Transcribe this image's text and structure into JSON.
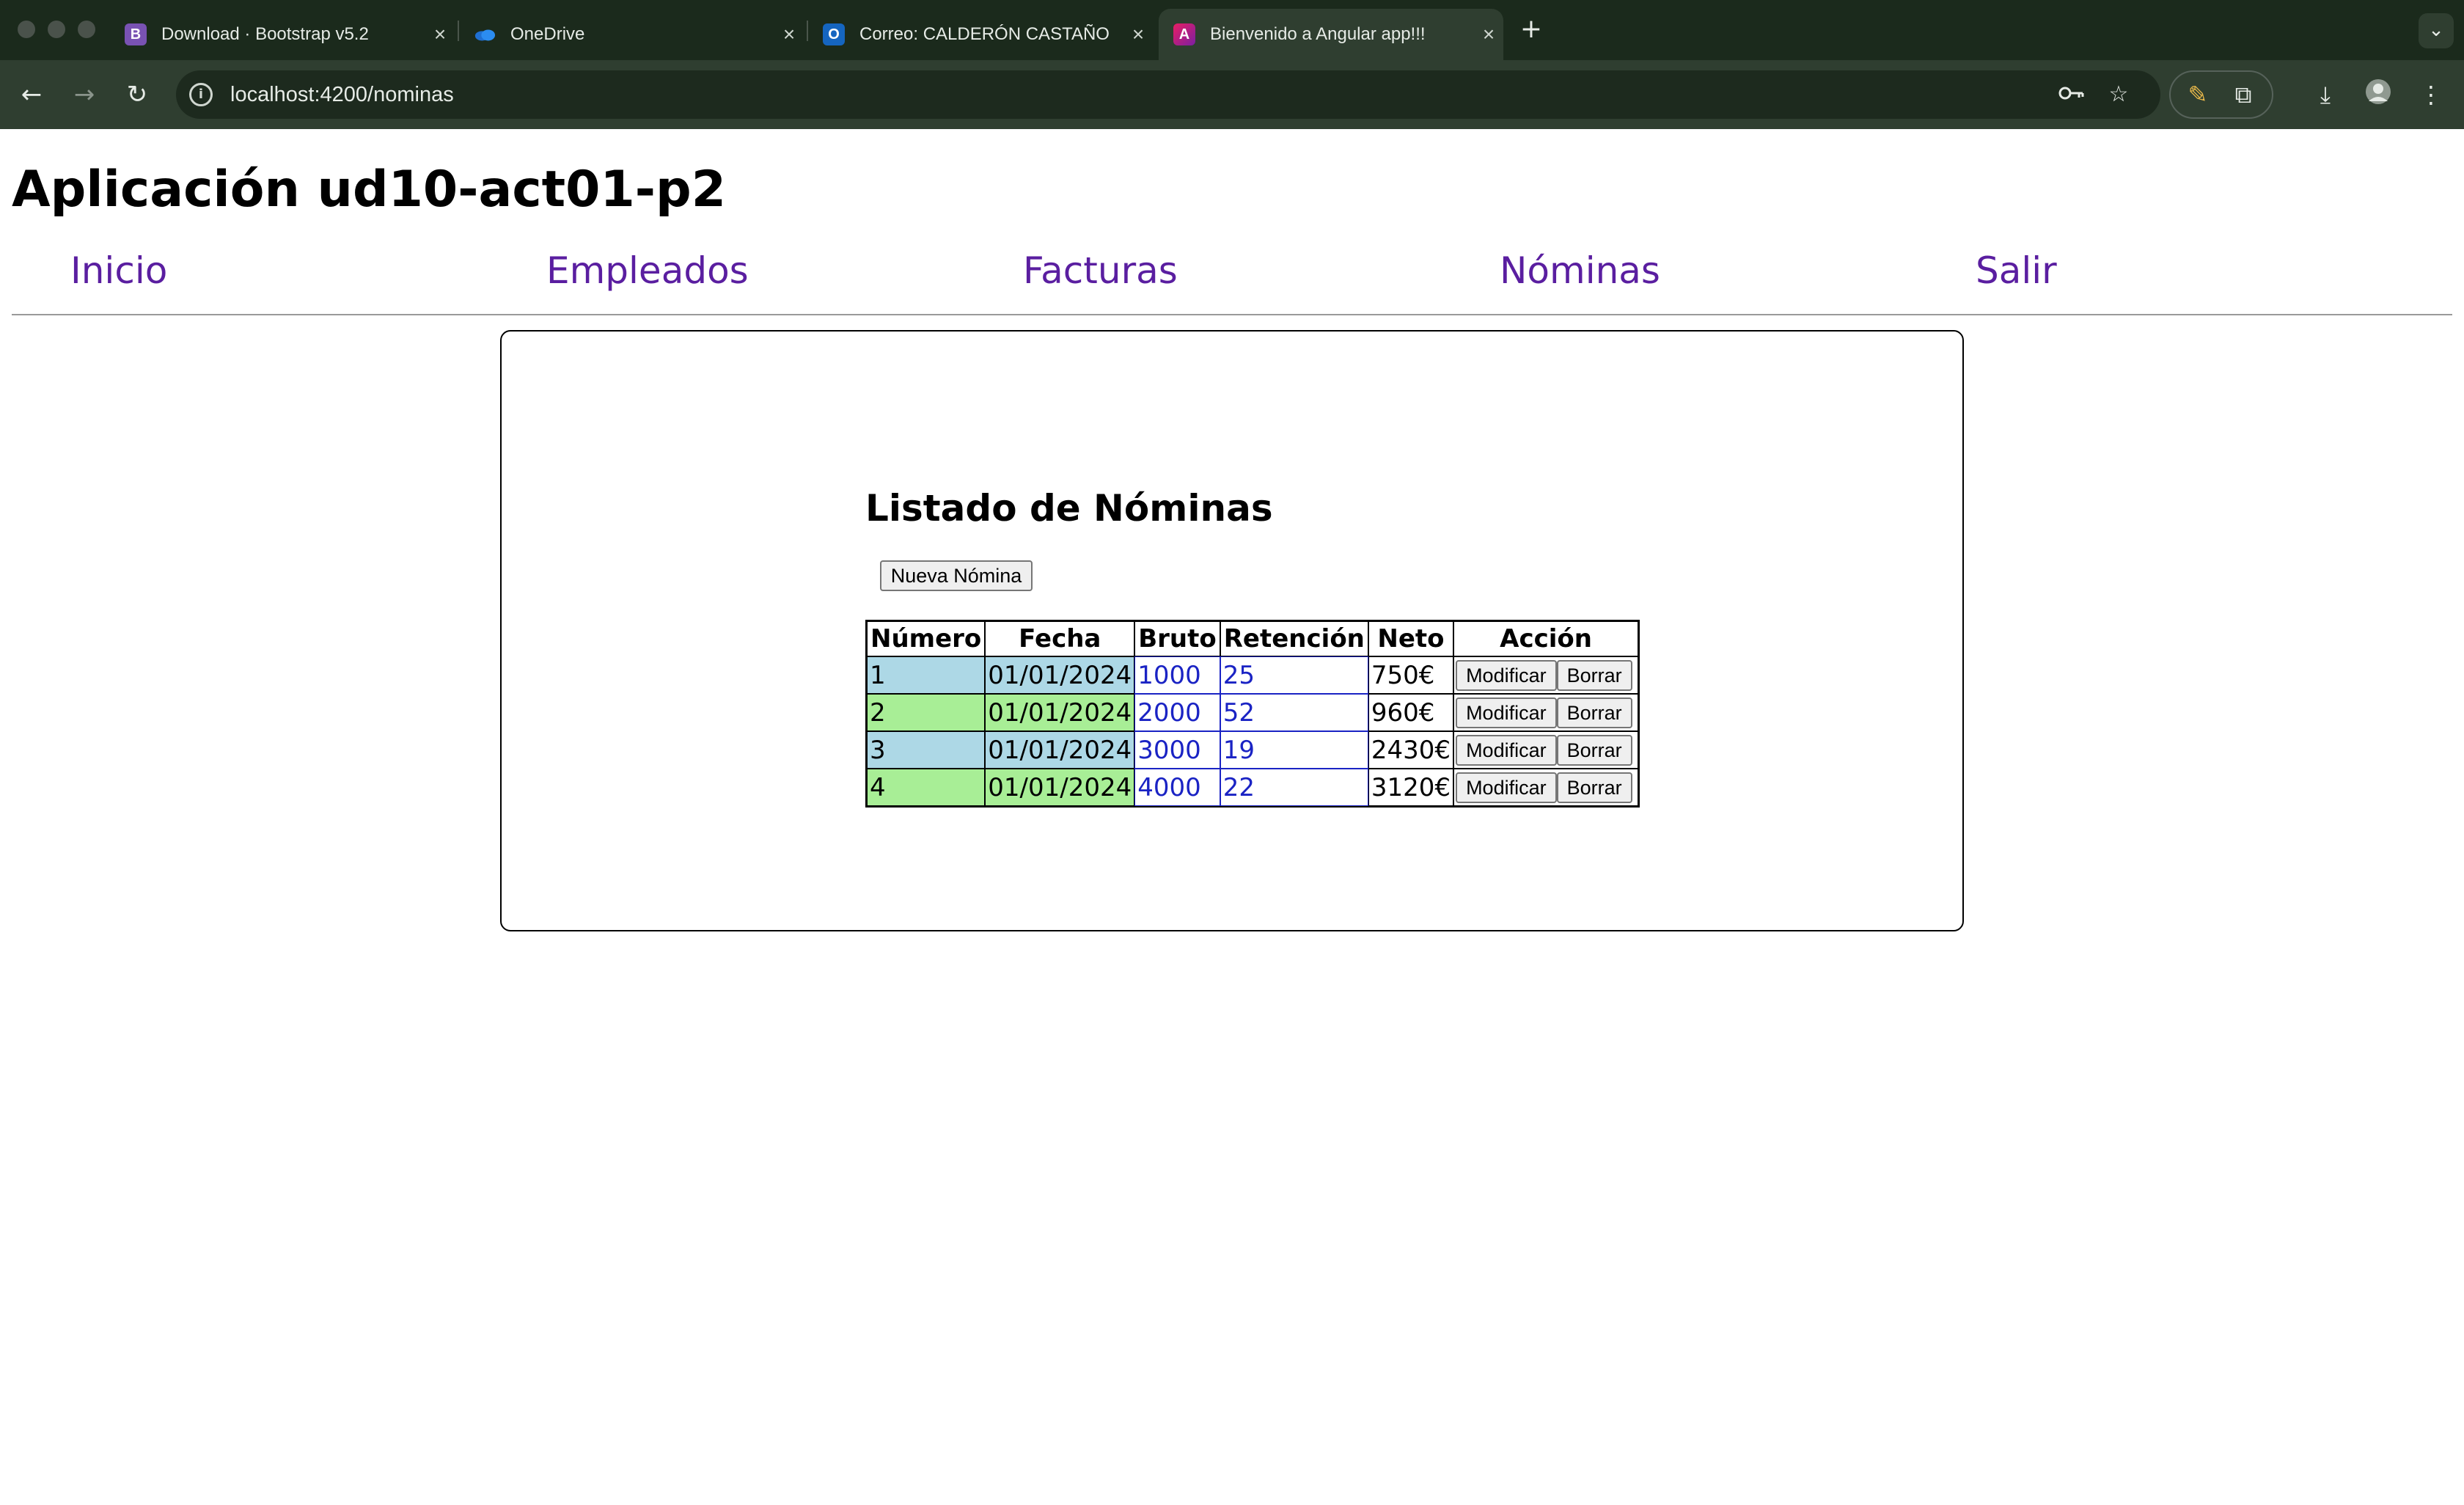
{
  "browser": {
    "tabs": [
      {
        "label": "Download · Bootstrap v5.2",
        "favicon": "B",
        "favicon_color": "#7952b3"
      },
      {
        "label": "OneDrive",
        "favicon": "",
        "favicon_color": "#1f6fd1"
      },
      {
        "label": "Correo: CALDERÓN CASTAÑO",
        "favicon": "O",
        "favicon_color": "#1565c0"
      },
      {
        "label": "Bienvenido a Angular app!!!",
        "favicon": "A",
        "favicon_color": "#c2185b"
      }
    ],
    "active_tab": 3,
    "url": "localhost:4200/nominas"
  },
  "app": {
    "title": "Aplicación ud10-act01-p2",
    "nav": [
      "Inicio",
      "Empleados",
      "Facturas",
      "Nóminas",
      "Salir"
    ]
  },
  "list": {
    "title": "Listado de Nóminas",
    "new_button": "Nueva Nómina",
    "columns": [
      "Número",
      "Fecha",
      "Bruto",
      "Retención",
      "Neto",
      "Acción"
    ],
    "rows": [
      {
        "numero": "1",
        "fecha": "01/01/2024",
        "bruto": "1000",
        "retencion": "25",
        "neto": "750€"
      },
      {
        "numero": "2",
        "fecha": "01/01/2024",
        "bruto": "2000",
        "retencion": "52",
        "neto": "960€"
      },
      {
        "numero": "3",
        "fecha": "01/01/2024",
        "bruto": "3000",
        "retencion": "19",
        "neto": "2430€"
      },
      {
        "numero": "4",
        "fecha": "01/01/2024",
        "bruto": "4000",
        "retencion": "22",
        "neto": "3120€"
      }
    ],
    "modify_label": "Modificar",
    "delete_label": "Borrar"
  },
  "colors": {
    "nav_link": "#5a1ea0",
    "row_blue": "#add8e6",
    "row_green": "#a8ee96",
    "value_blue": "#1a23c4"
  }
}
